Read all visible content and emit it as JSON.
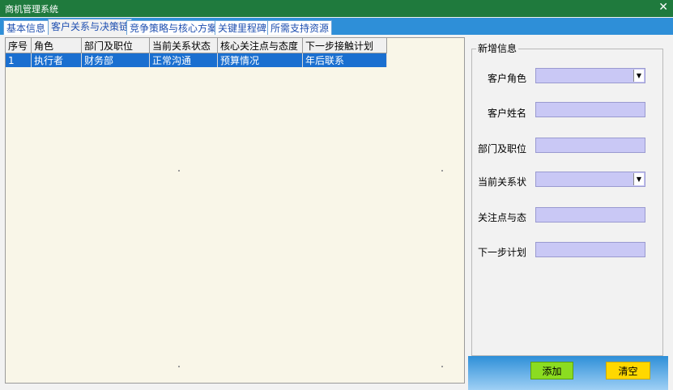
{
  "window": {
    "title": "商机管理系统",
    "close_glyph": "✕"
  },
  "tabs": [
    {
      "label": "基本信息"
    },
    {
      "label": "客户关系与决策链"
    },
    {
      "label": "竞争策略与核心方案"
    },
    {
      "label": "关键里程碑"
    },
    {
      "label": "所需支持资源"
    }
  ],
  "table": {
    "columns": [
      "序号",
      "角色",
      "部门及职位",
      "当前关系状态",
      "核心关注点与态度",
      "下一步接触计划"
    ],
    "rows": [
      [
        "1",
        "执行者",
        "财务部",
        "正常沟通",
        "预算情况",
        "年后联系"
      ]
    ]
  },
  "form": {
    "legend": "新增信息",
    "fields": [
      {
        "label": "客户角色",
        "value": ""
      },
      {
        "label": "客户姓名",
        "value": ""
      },
      {
        "label": "部门及职位",
        "value": ""
      },
      {
        "label": "当前关系状",
        "value": ""
      },
      {
        "label": "关注点与态",
        "value": ""
      },
      {
        "label": "下一步计划",
        "value": ""
      }
    ],
    "dropdown_glyph": "▼",
    "add_label": "添加",
    "clear_label": "清空"
  },
  "colors": {
    "titlebar": "#1f7a3d",
    "tabstrip": "#2e8fd8",
    "selection": "#1a6fd0",
    "field_bg": "#c9c8f5",
    "add_button": "#8bdc20",
    "clear_button": "#ffd800"
  }
}
